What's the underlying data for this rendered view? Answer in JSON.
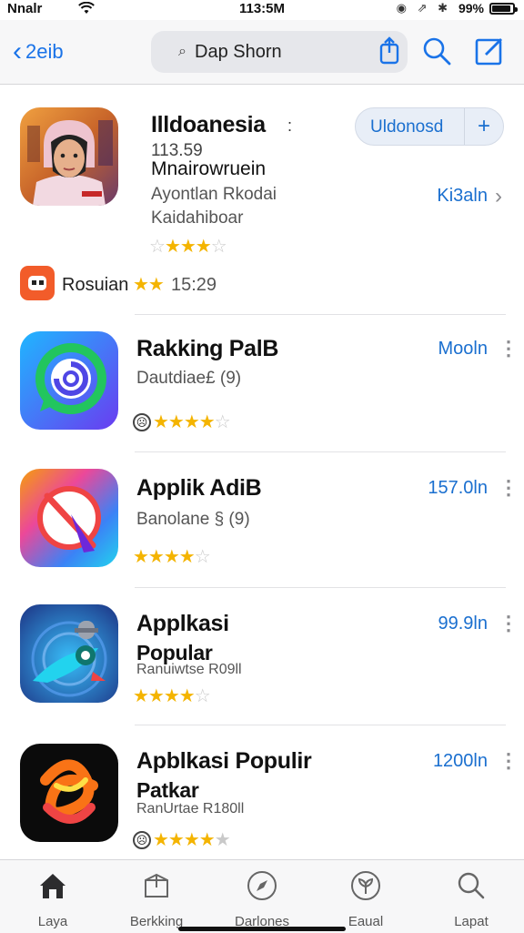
{
  "status": {
    "carrier": "Nnalr",
    "time": "113:5M",
    "battery": "99%"
  },
  "nav": {
    "back_label": "2eib",
    "search_text": "Dap Shorn"
  },
  "featured": {
    "title": "Illdoanesia",
    "version": "113.59",
    "subtitle": "Mnairowruein",
    "line1": "Ayontlan Rkodai",
    "line2": "Kaidahiboar",
    "button_label": "Uldonosd",
    "button_plus": "+",
    "link": "Ki3aln",
    "rating": 3.5
  },
  "mini": {
    "label": "Rosuian",
    "count": "15:29",
    "rating": 2
  },
  "apps": [
    {
      "title": "Rakking PalB",
      "title2": "",
      "sub": "Dautdiae£ (9)",
      "get": "Mooln",
      "rating": 3.5,
      "badge": true
    },
    {
      "title": "Applik  AdiB",
      "title2": "",
      "sub": "Banolane § (9)",
      "get": "157.0ln",
      "rating": 3.5,
      "badge": false
    },
    {
      "title": "Applkasi",
      "title2": "Popular",
      "sub": "Ranuiwtse R09ll",
      "get": "99.9ln",
      "rating": 3.5,
      "badge": false
    },
    {
      "title": "Apblkasi Populir",
      "title2": "Patkar",
      "sub": "RanUrtae R180ll",
      "get": "1200ln",
      "rating": 4,
      "badge": true
    }
  ],
  "tabs": [
    {
      "label": "Laya",
      "icon": "home-icon"
    },
    {
      "label": "Berkking",
      "icon": "package-icon"
    },
    {
      "label": "Darlones",
      "icon": "compass-icon"
    },
    {
      "label": "Eaual",
      "icon": "plant-icon"
    },
    {
      "label": "Lapat",
      "icon": "search-icon"
    }
  ],
  "colors": {
    "accent": "#1a6fcf",
    "star": "#f4b400"
  }
}
